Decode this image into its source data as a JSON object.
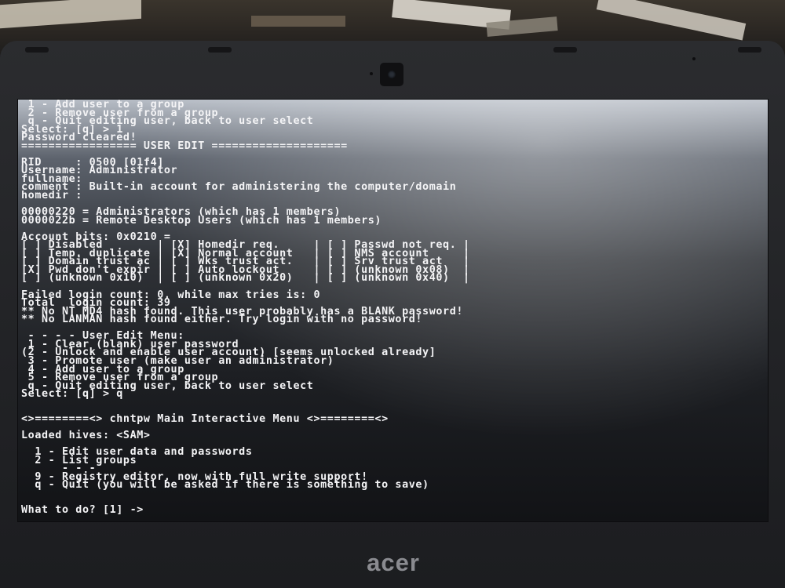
{
  "laptop": {
    "brand": "acer"
  },
  "terminal": {
    "lines": [
      " 1 - Add user to a group",
      " 2 - Remove user from a group",
      " q - Quit editing user, back to user select",
      "Select: [q] > 1",
      "Password cleared!",
      "================= USER EDIT ====================",
      "",
      "RID     : 0500 [01f4]",
      "Username: Administrator",
      "fullname:",
      "comment : Built-in account for administering the computer/domain",
      "homedir :",
      "",
      "00000220 = Administrators (which has 1 members)",
      "0000022b = Remote Desktop Users (which has 1 members)",
      "",
      "Account bits: 0x0210 =",
      "[ ] Disabled        | [X] Homedir req.     | [ ] Passwd not req. |",
      "[ ] Temp. duplicate | [X] Normal account   | [ ] NMS account     |",
      "[ ] Domain trust ac | [ ] Wks trust act.   | [ ] Srv trust act   |",
      "[X] Pwd don't expir | [ ] Auto lockout     | [ ] (unknown 0x08)  |",
      "[ ] (unknown 0x10)  | [ ] (unknown 0x20)   | [ ] (unknown 0x40)  |",
      "",
      "Failed login count: 0, while max tries is: 0",
      "Total  login count: 39",
      "** No NT MD4 hash found. This user probably has a BLANK password!",
      "** No LANMAN hash found either. Try login with no password!",
      "",
      " - - - - User Edit Menu:",
      " 1 - Clear (blank) user password",
      "(2 - Unlock and enable user account) [seems unlocked already]",
      " 3 - Promote user (make user an administrator)",
      " 4 - Add user to a group",
      " 5 - Remove user from a group",
      " q - Quit editing user, back to user select",
      "Select: [q] > q",
      "",
      "",
      "<>========<> chntpw Main Interactive Menu <>========<>",
      "",
      "Loaded hives: <SAM>",
      "",
      "  1 - Edit user data and passwords",
      "  2 - List groups",
      "      - - -",
      "  9 - Registry editor, now with full write support!",
      "  q - Quit (you will be asked if there is something to save)",
      "",
      "",
      "What to do? [1] ->"
    ]
  }
}
